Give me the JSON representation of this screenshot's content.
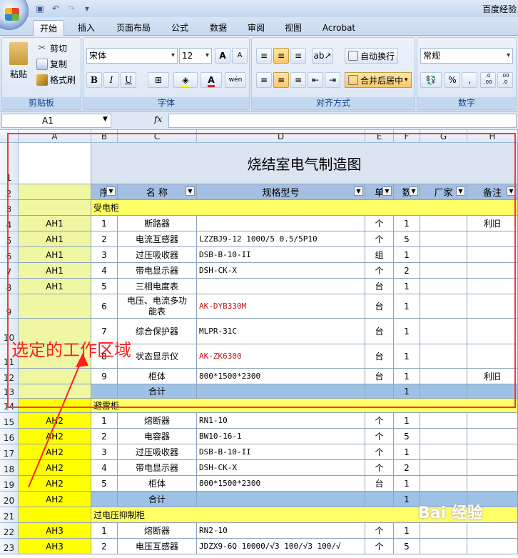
{
  "window": {
    "title": "百度经验"
  },
  "tabs": [
    {
      "label": "开始",
      "active": true
    },
    {
      "label": "插入"
    },
    {
      "label": "页面布局"
    },
    {
      "label": "公式"
    },
    {
      "label": "数据"
    },
    {
      "label": "审阅"
    },
    {
      "label": "视图"
    },
    {
      "label": "Acrobat"
    }
  ],
  "ribbon": {
    "clipboard": {
      "paste": "粘贴",
      "cut": "剪切",
      "copy": "复制",
      "format_painter": "格式刷",
      "label": "剪贴板"
    },
    "font": {
      "name": "宋体",
      "size": "12",
      "label": "字体",
      "bold": "B",
      "italic": "I",
      "underline": "U",
      "grow": "A",
      "shrink": "A",
      "font_color": "A",
      "phonetic": "wén"
    },
    "alignment": {
      "wrap": "自动换行",
      "merge": "合并后居中",
      "label": "对齐方式"
    },
    "number": {
      "format": "常规",
      "percent": "%",
      "comma": ",",
      "inc": ".0 .00",
      "dec": ".00 .0",
      "label": "数字"
    }
  },
  "formula_bar": {
    "name_box": "A1",
    "fx": "fx",
    "value": ""
  },
  "columns": [
    "A",
    "B",
    "C",
    "D",
    "E",
    "F",
    "G",
    "H"
  ],
  "rows": [
    "1",
    "2",
    "3",
    "4",
    "5",
    "6",
    "7",
    "8",
    "9",
    "10",
    "11",
    "12",
    "13",
    "14",
    "15",
    "16",
    "17",
    "18",
    "19",
    "20",
    "21",
    "22",
    "23"
  ],
  "sheet": {
    "title": "烧结室电气制造图",
    "headers": {
      "seq": "序",
      "name": "名 称",
      "spec": "规格型号",
      "unit": "单",
      "qty": "数",
      "maker": "厂家",
      "note": "备注"
    },
    "section1": "受电柜",
    "section2": "避雷柜",
    "section3": "过电压抑制柜",
    "sum_label": "合计",
    "rows1": [
      {
        "a": "AH1",
        "b": "1",
        "c": "断路器",
        "d": "",
        "e": "个",
        "f": "1",
        "h": "利旧"
      },
      {
        "a": "AH1",
        "b": "2",
        "c": "电流互感器",
        "d": "LZZBJ9-12  1000/5  0.5/5P10",
        "e": "个",
        "f": "5",
        "h": ""
      },
      {
        "a": "AH1",
        "b": "3",
        "c": "过压吸收器",
        "d": "DSB-B-10-II",
        "e": "组",
        "f": "1",
        "h": ""
      },
      {
        "a": "AH1",
        "b": "4",
        "c": "带电显示器",
        "d": "DSH-CK-X",
        "e": "个",
        "f": "2",
        "h": ""
      },
      {
        "a": "AH1",
        "b": "5",
        "c": "三相电度表",
        "d": "",
        "e": "台",
        "f": "1",
        "h": ""
      },
      {
        "a": "",
        "b": "6",
        "c": "电压、电流多功能表",
        "c1": "电压、电流多功",
        "c2": "能表",
        "d": "AK-DYB330M",
        "e": "台",
        "f": "1",
        "h": ""
      },
      {
        "a": "",
        "b": "7",
        "c": "综合保护器",
        "d": "MLPR-31C",
        "e": "台",
        "f": "1",
        "h": ""
      },
      {
        "a": "",
        "b": "8",
        "c": "状态显示仪",
        "d": "AK-ZK6300",
        "e": "台",
        "f": "1",
        "h": ""
      },
      {
        "a": "",
        "b": "9",
        "c": "柜体",
        "d": "800*1500*2300",
        "e": "台",
        "f": "1",
        "h": "利旧"
      }
    ],
    "sum1_qty": "1",
    "rows2": [
      {
        "a": "AH2",
        "b": "1",
        "c": "熔断器",
        "d": "RN1-10",
        "e": "个",
        "f": "1"
      },
      {
        "a": "AH2",
        "b": "2",
        "c": "电容器",
        "d": "BW10-16-1",
        "e": "个",
        "f": "5"
      },
      {
        "a": "AH2",
        "b": "3",
        "c": "过压吸收器",
        "d": "DSB-B-10-II",
        "e": "个",
        "f": "1"
      },
      {
        "a": "AH2",
        "b": "4",
        "c": "带电显示器",
        "d": "DSH-CK-X",
        "e": "个",
        "f": "2"
      },
      {
        "a": "AH2",
        "b": "5",
        "c": "柜体",
        "d": "800*1500*2300",
        "e": "台",
        "f": "1"
      }
    ],
    "sum2_a": "AH2",
    "sum2_qty": "1",
    "rows3": [
      {
        "a": "AH3",
        "b": "1",
        "c": "熔断器",
        "d": "RN2-10",
        "e": "个",
        "f": "1"
      },
      {
        "a": "AH3",
        "b": "2",
        "c": "电压互感器",
        "d": "JDZX9-6Q 10000/√3 100/√3 100/√",
        "e": "个",
        "f": "5"
      }
    ]
  },
  "annotation": {
    "text": "选定的工作区域",
    "color": "#ff2020"
  },
  "watermark": "Bai 经验"
}
